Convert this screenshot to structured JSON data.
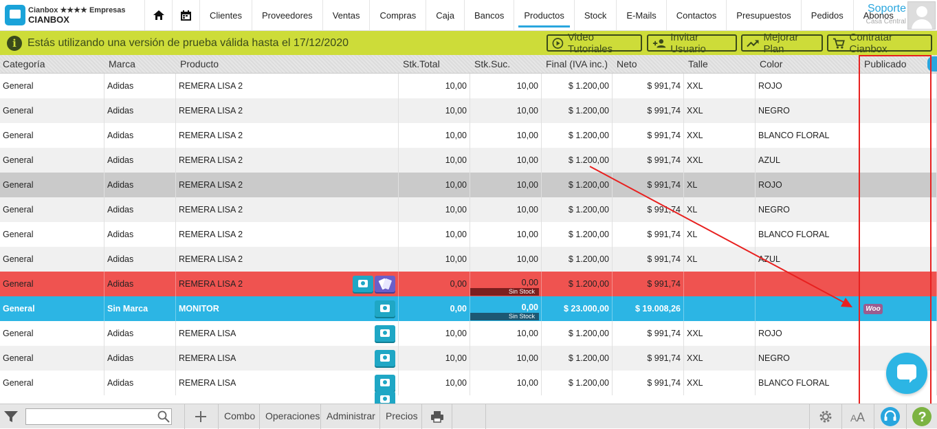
{
  "app": {
    "subtitle": "Cianbox ★★★★ Empresas",
    "name": "CIANBOX"
  },
  "nav": [
    "Clientes",
    "Proveedores",
    "Ventas",
    "Compras",
    "Caja",
    "Bancos",
    "Productos",
    "Stock",
    "E-Mails",
    "Contactos",
    "Presupuestos",
    "Pedidos",
    "Abonos"
  ],
  "nav_active": "Productos",
  "user": {
    "name": "Soporte",
    "branch": "Casa Central"
  },
  "trial": {
    "message": "Estás utilizando una versión de prueba válida hasta el 17/12/2020",
    "buttons": [
      "Video Tutoriales",
      "Invitar Usuario",
      "Mejorar Plan",
      "Contratar Cianbox"
    ]
  },
  "table": {
    "columns": [
      "Categoría",
      "Marca",
      "Producto",
      "Stk.Total",
      "Stk.Suc.",
      "Final (IVA inc.)",
      "Neto",
      "Talle",
      "Color",
      "Publicado"
    ],
    "rows": [
      [
        "General",
        "Adidas",
        "REMERA LISA 2",
        "10,00",
        "10,00",
        "$ 1.200,00",
        "$ 991,74",
        "XXL",
        "ROJO",
        ""
      ],
      [
        "General",
        "Adidas",
        "REMERA LISA 2",
        "10,00",
        "10,00",
        "$ 1.200,00",
        "$ 991,74",
        "XXL",
        "NEGRO",
        ""
      ],
      [
        "General",
        "Adidas",
        "REMERA LISA 2",
        "10,00",
        "10,00",
        "$ 1.200,00",
        "$ 991,74",
        "XXL",
        "BLANCO FLORAL",
        ""
      ],
      [
        "General",
        "Adidas",
        "REMERA LISA 2",
        "10,00",
        "10,00",
        "$ 1.200,00",
        "$ 991,74",
        "XXL",
        "AZUL",
        ""
      ],
      [
        "General",
        "Adidas",
        "REMERA LISA 2",
        "10,00",
        "10,00",
        "$ 1.200,00",
        "$ 991,74",
        "XL",
        "ROJO",
        ""
      ],
      [
        "General",
        "Adidas",
        "REMERA LISA 2",
        "10,00",
        "10,00",
        "$ 1.200,00",
        "$ 991,74",
        "XL",
        "NEGRO",
        ""
      ],
      [
        "General",
        "Adidas",
        "REMERA LISA 2",
        "10,00",
        "10,00",
        "$ 1.200,00",
        "$ 991,74",
        "XL",
        "BLANCO FLORAL",
        ""
      ],
      [
        "General",
        "Adidas",
        "REMERA LISA 2",
        "10,00",
        "10,00",
        "$ 1.200,00",
        "$ 991,74",
        "XL",
        "AZUL",
        ""
      ],
      [
        "General",
        "Adidas",
        "REMERA LISA 2",
        "0,00",
        "0,00",
        "$ 1.200,00",
        "$ 991,74",
        "",
        "",
        ""
      ],
      [
        "General",
        "Sin Marca",
        "MONITOR",
        "0,00",
        "0,00",
        "$ 23.000,00",
        "$ 19.008,26",
        "",
        "",
        "Woo"
      ],
      [
        "General",
        "Adidas",
        "REMERA LISA",
        "10,00",
        "10,00",
        "$ 1.200,00",
        "$ 991,74",
        "XXL",
        "ROJO",
        ""
      ],
      [
        "General",
        "Adidas",
        "REMERA LISA",
        "10,00",
        "10,00",
        "$ 1.200,00",
        "$ 991,74",
        "XXL",
        "NEGRO",
        ""
      ],
      [
        "General",
        "Adidas",
        "REMERA LISA",
        "10,00",
        "10,00",
        "$ 1.200,00",
        "$ 991,74",
        "XXL",
        "BLANCO FLORAL",
        ""
      ]
    ],
    "sin_stock_label": "Sin Stock"
  },
  "bottom": {
    "search_value": "",
    "buttons": [
      "Combo",
      "Operaciones",
      "Administrar",
      "Precios"
    ]
  },
  "colors": {
    "accent": "#29a6de",
    "trial_bar": "#cddc39",
    "row_no_stock": "#ef5350",
    "row_selected": "#2cb5e4",
    "highlight": "#e8201f"
  }
}
